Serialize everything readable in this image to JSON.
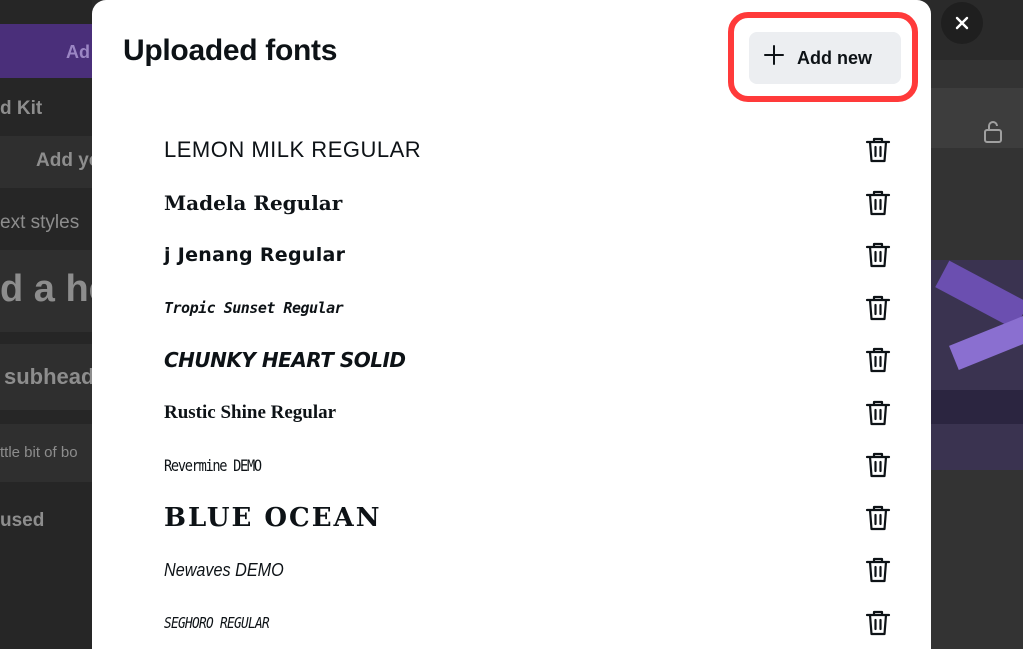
{
  "background_app": {
    "left_fragments": [
      "Ad",
      "d Kit",
      "Add yo",
      "ext styles",
      "d a he",
      "subhead",
      "ttle bit of bo",
      "used"
    ]
  },
  "modal": {
    "title": "Uploaded fonts",
    "add_button": {
      "icon": "plus-icon",
      "label": "Add new"
    },
    "fonts": [
      {
        "name": "LEMON MILK REGULAR"
      },
      {
        "name": "Madela Regular"
      },
      {
        "name": "j Jenang Regular"
      },
      {
        "name": "Tropic Sunset Regular"
      },
      {
        "name": "CHUNKY HEART SOLID"
      },
      {
        "name": "Rustic Shine Regular"
      },
      {
        "name": "Revermine DEMO"
      },
      {
        "name": "BLUE OCEAN"
      },
      {
        "name": "Newaves DEMO"
      },
      {
        "name": "SEGHORO REGULAR"
      }
    ],
    "delete_icon": "trash-icon"
  },
  "colors": {
    "highlight": "#ff3a3a",
    "add_button_bg": "#eceef1",
    "brand_purple": "#4a2f7a"
  }
}
